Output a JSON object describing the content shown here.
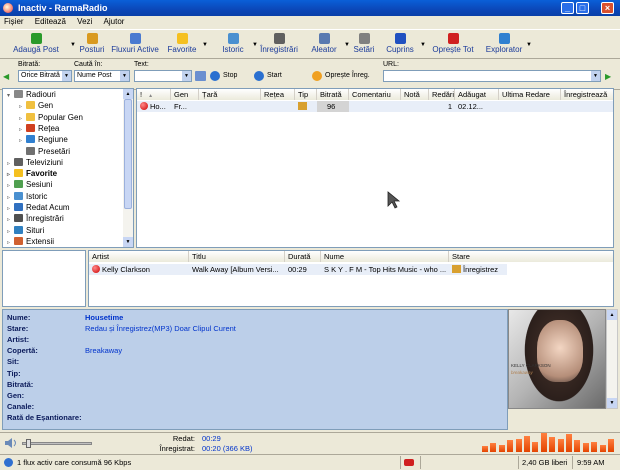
{
  "window": {
    "title": "Inactiv - RarmaRadio",
    "minimize": "_",
    "maximize": "□",
    "close": "×"
  },
  "menu": [
    "Fișier",
    "Editează",
    "Vezi",
    "Ajutor"
  ],
  "toolbar": [
    {
      "label": "Adaugă Post",
      "icon": "plus-icon",
      "color": "#2a9a2a",
      "dropdown": true
    },
    {
      "label": "Posturi",
      "icon": "folder-icon",
      "color": "#d99a20",
      "dropdown": false
    },
    {
      "label": "Fluxuri Active",
      "icon": "stream-icon",
      "color": "#4a7ad0",
      "dropdown": false
    },
    {
      "label": "Favorite",
      "icon": "star-icon",
      "color": "#f5c020",
      "dropdown": true
    },
    {
      "label": "Istoric",
      "icon": "calendar-icon",
      "color": "#4a90d0",
      "dropdown": true
    },
    {
      "label": "Înregistrări",
      "icon": "disk-icon",
      "color": "#606060",
      "dropdown": false
    },
    {
      "label": "Aleator",
      "icon": "shuffle-icon",
      "color": "#5a7ab0",
      "dropdown": true
    },
    {
      "label": "Setări",
      "icon": "wrench-icon",
      "color": "#808080",
      "dropdown": false
    },
    {
      "label": "Cuprins",
      "icon": "help-icon",
      "color": "#2050c0",
      "dropdown": true
    },
    {
      "label": "Oprește Tot",
      "icon": "stop-icon",
      "color": "#d02020",
      "dropdown": false
    },
    {
      "label": "Explorator",
      "icon": "globe-icon",
      "color": "#3080d0",
      "dropdown": true
    }
  ],
  "filters": {
    "bitrate_label": "Bitrată:",
    "bitrate_value": "Orice Bitrată",
    "search_in_label": "Caută în:",
    "search_in_value": "Nume Post",
    "text_label": "Text:",
    "text_value": "",
    "stop_label": "Stop",
    "start_label": "Start",
    "stop_rec_label": "Oprește Înreg.",
    "url_label": "URL:",
    "url_value": ""
  },
  "tree": [
    {
      "label": "Radiouri",
      "level": 0,
      "icon": "radio-icon",
      "twisty": "▾",
      "bold": false
    },
    {
      "label": "Gen",
      "level": 1,
      "icon": "folder-icon",
      "twisty": "▹",
      "bold": false
    },
    {
      "label": "Popular Gen",
      "level": 1,
      "icon": "folder-icon",
      "twisty": "▹",
      "bold": false
    },
    {
      "label": "Rețea",
      "level": 1,
      "icon": "network-icon",
      "twisty": "▹",
      "bold": false
    },
    {
      "label": "Regiune",
      "level": 1,
      "icon": "globe-icon",
      "twisty": "▹",
      "bold": false
    },
    {
      "label": "Presetări",
      "level": 1,
      "icon": "preset-icon",
      "twisty": "",
      "bold": false
    },
    {
      "label": "Televiziuni",
      "level": 0,
      "icon": "tv-icon",
      "twisty": "▹",
      "bold": false
    },
    {
      "label": "Favorite",
      "level": 0,
      "icon": "star-icon",
      "twisty": "▹",
      "bold": true
    },
    {
      "label": "Sesiuni",
      "level": 0,
      "icon": "session-icon",
      "twisty": "▹",
      "bold": false
    },
    {
      "label": "Istoric",
      "level": 0,
      "icon": "calendar-icon",
      "twisty": "▹",
      "bold": false
    },
    {
      "label": "Redat Acum",
      "level": 0,
      "icon": "now-playing-icon",
      "twisty": "▹",
      "bold": false
    },
    {
      "label": "Înregistrări",
      "level": 0,
      "icon": "disk-icon",
      "twisty": "▹",
      "bold": false
    },
    {
      "label": "Situri",
      "level": 0,
      "icon": "site-icon",
      "twisty": "▹",
      "bold": false
    },
    {
      "label": "Extensii",
      "level": 0,
      "icon": "plugin-icon",
      "twisty": "▹",
      "bold": false
    }
  ],
  "stations": {
    "columns": [
      "!",
      "Gen",
      "Țară",
      "Rețea",
      "Tip",
      "Bitrată",
      "Comentariu",
      "Notă",
      "Redări",
      "Adăugat",
      "Ultima Redare",
      "Înregistrează"
    ],
    "sort_indicator": "▲",
    "rows": [
      {
        "name": "Ho...",
        "genre": "Fr...",
        "country": "",
        "network": "",
        "type": "",
        "bitrate": "96",
        "comment": "",
        "rating": "",
        "plays": "1",
        "added": "02.12...",
        "last": "",
        "record": ""
      }
    ]
  },
  "tracks": {
    "columns": [
      "Artist",
      "Titlu",
      "Durată",
      "Nume",
      "Stare"
    ],
    "rows": [
      {
        "artist": "Kelly Clarkson",
        "title": "Walk Away [Album Versi...",
        "duration": "00:29",
        "name": "S K Y . F M - Top Hits Music - who ...",
        "state": "Înregistrez"
      }
    ]
  },
  "info": [
    {
      "label": "Nume:",
      "value": "Housetime",
      "bold": true
    },
    {
      "label": "Stare:",
      "value": "Redau și Înregistrez(MP3) Doar Clipul Curent",
      "bold": false
    },
    {
      "label": "Artist:",
      "value": "",
      "bold": false
    },
    {
      "label": "Copertă:",
      "value": "Breakaway",
      "bold": false
    },
    {
      "label": "Sit:",
      "value": "",
      "bold": false
    },
    {
      "label": "Tip:",
      "value": "",
      "bold": false
    },
    {
      "label": "Bitrată:",
      "value": "",
      "bold": false
    },
    {
      "label": "Gen:",
      "value": "",
      "bold": false
    },
    {
      "label": "Canale:",
      "value": "",
      "bold": false
    },
    {
      "label": "Rată de Eșantionare:",
      "value": "",
      "bold": false
    }
  ],
  "cover": {
    "artist_text": "KELLY CLARKSON",
    "album_text": "breakaway"
  },
  "playback": {
    "played_label": "Redat:",
    "played_value": "00:29",
    "recorded_label": "Înregistrat:",
    "recorded_value": "00:20 (366 KB)",
    "volume": 0.05
  },
  "equalizer": [
    4,
    6,
    5,
    8,
    9,
    11,
    7,
    13,
    10,
    9,
    12,
    8,
    6,
    7,
    5,
    9
  ],
  "status": {
    "streams": "1 flux activ care consumă 96 Kbps",
    "disk": "2,40 GB liberi",
    "time": "9:59 AM"
  }
}
